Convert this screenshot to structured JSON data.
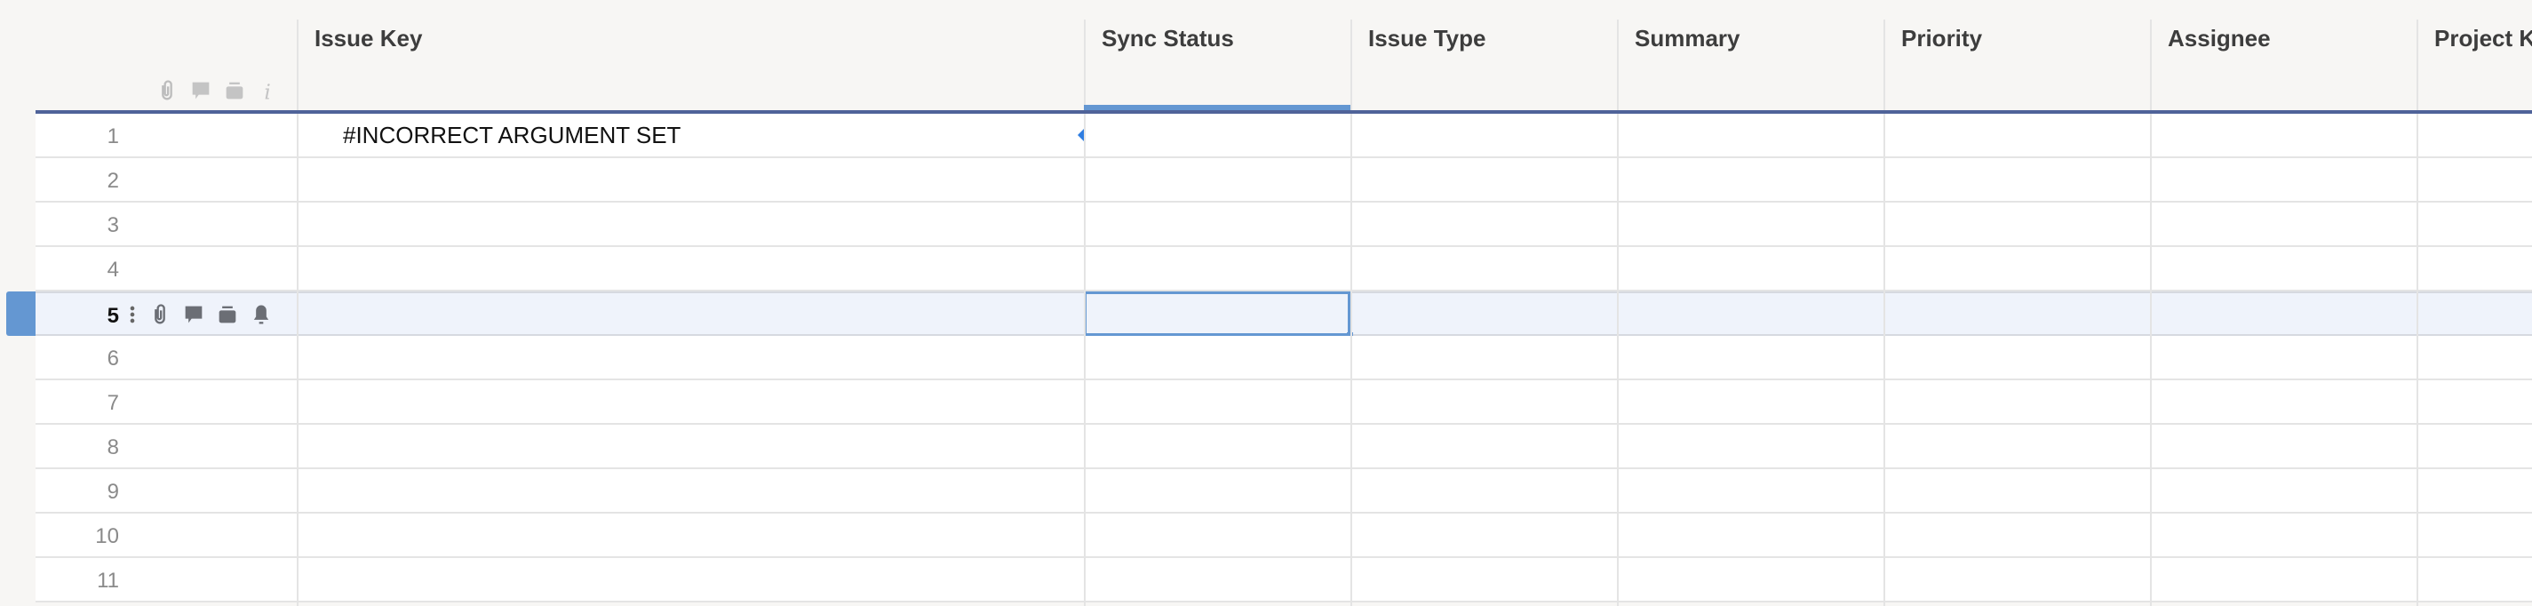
{
  "columns": [
    {
      "key": "issue_key",
      "label": "Issue Key"
    },
    {
      "key": "sync_status",
      "label": "Sync Status"
    },
    {
      "key": "issue_type",
      "label": "Issue Type"
    },
    {
      "key": "summary",
      "label": "Summary"
    },
    {
      "key": "priority",
      "label": "Priority"
    },
    {
      "key": "assignee",
      "label": "Assignee"
    },
    {
      "key": "project_key",
      "label": "Project Key"
    }
  ],
  "header_icons": [
    "paperclip-icon",
    "comment-icon",
    "archive-icon",
    "info-icon"
  ],
  "row_icons": [
    "more-vertical-icon",
    "paperclip-icon",
    "comment-icon",
    "archive-icon",
    "bell-icon"
  ],
  "rows": [
    {
      "num": "1",
      "issue_key": "#INCORRECT ARGUMENT SET"
    },
    {
      "num": "2"
    },
    {
      "num": "3"
    },
    {
      "num": "4"
    },
    {
      "num": "5"
    },
    {
      "num": "6"
    },
    {
      "num": "7"
    },
    {
      "num": "8"
    },
    {
      "num": "9"
    },
    {
      "num": "10"
    },
    {
      "num": "11"
    }
  ],
  "selected_row": 5,
  "selected_column": "Sync Status",
  "colors": {
    "accent": "#6497d2",
    "header_line": "#4f6399",
    "selected_row_bg": "#eff3fb"
  }
}
